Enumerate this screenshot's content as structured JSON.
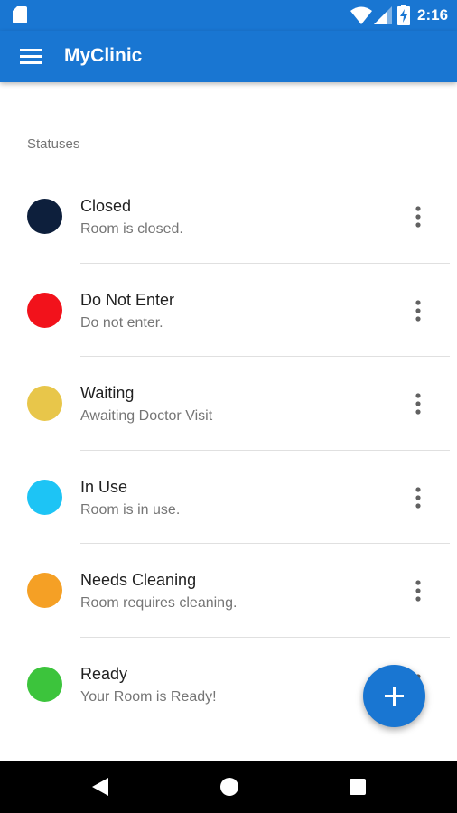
{
  "status_bar": {
    "time": "2:16",
    "icons": [
      "sd-card-icon",
      "wifi-icon",
      "cell-signal-icon",
      "battery-charging-icon"
    ]
  },
  "app_bar": {
    "title": "MyClinic",
    "menu_icon": "hamburger-menu-icon",
    "color": "#1976d2"
  },
  "section": {
    "header": "Statuses"
  },
  "statuses": [
    {
      "name": "Closed",
      "description": "Room is closed.",
      "color": "#0d1f3c"
    },
    {
      "name": "Do Not Enter",
      "description": "Do not enter.",
      "color": "#f2121b"
    },
    {
      "name": "Waiting",
      "description": "Awaiting Doctor Visit",
      "color": "#e8c64a"
    },
    {
      "name": "In Use",
      "description": "Room is in use.",
      "color": "#1dc4f5"
    },
    {
      "name": "Needs Cleaning",
      "description": "Room requires cleaning.",
      "color": "#f5a025"
    },
    {
      "name": "Ready",
      "description": "Your Room is Ready!",
      "color": "#3cc43c"
    }
  ],
  "fab": {
    "icon": "plus-icon",
    "color": "#1976d2"
  },
  "nav_bar": {
    "icons": [
      "back-icon",
      "home-icon",
      "recents-icon"
    ]
  }
}
